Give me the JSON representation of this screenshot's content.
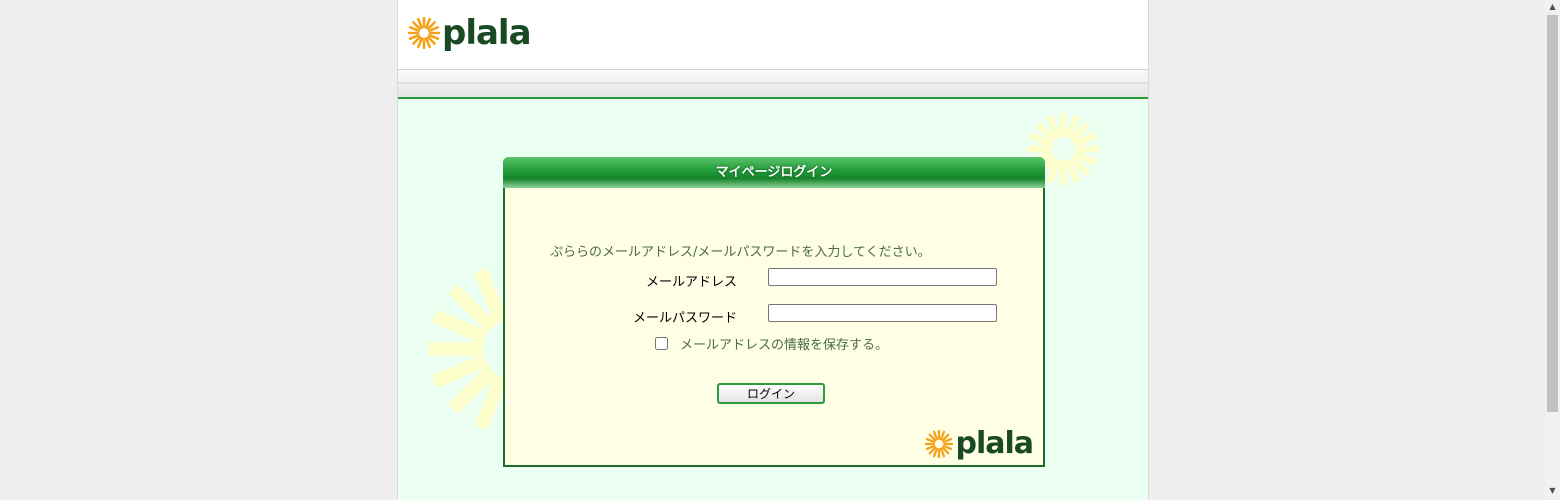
{
  "header": {
    "logo_text": "plala"
  },
  "login": {
    "title": "マイページログイン",
    "instruction": "ぷららのメールアドレス/メールパスワードを入力してください。",
    "email_label": "メールアドレス",
    "email_value": "",
    "password_label": "メールパスワード",
    "password_value": "",
    "remember_label": "メールアドレスの情報を保存する。",
    "remember_checked": false,
    "button_label": "ログイン",
    "footer_logo_text": "plala"
  },
  "colors": {
    "brand_green": "#1a4a24",
    "accent_green": "#2b9a3a",
    "logo_orange": "#f5a31a",
    "content_bg": "#ebfff3",
    "box_bg": "#ffffe6"
  },
  "icons": {
    "logo": "sunburst-logo-icon",
    "decoration": "sunburst-decoration-icon"
  }
}
